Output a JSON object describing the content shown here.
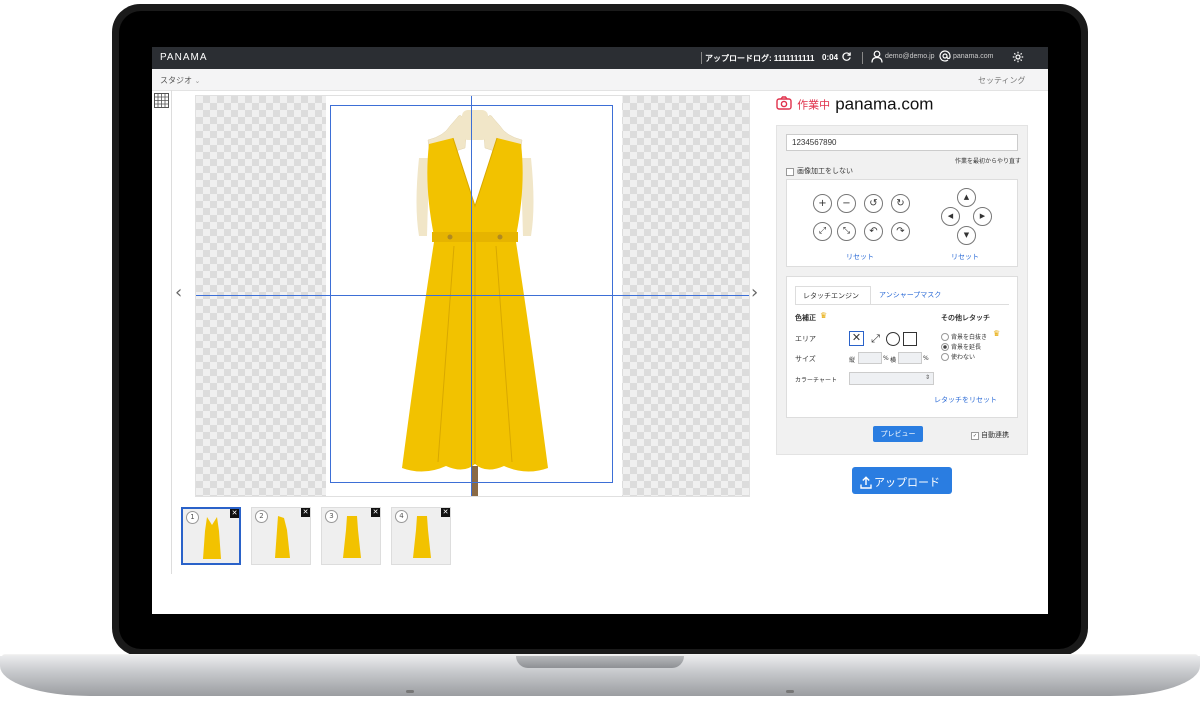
{
  "app": {
    "brand": "PANAMA",
    "upload_log_label": "アップロードログ: 1111111111",
    "timer": "0:04",
    "user_email": "demo@demo.jp",
    "domain": "panama.com"
  },
  "subbar": {
    "studio_label": "スタジオ",
    "settings_label": "セッティング"
  },
  "thumbnails": [
    {
      "num": "1",
      "selected": true
    },
    {
      "num": "2",
      "selected": false
    },
    {
      "num": "3",
      "selected": false
    },
    {
      "num": "4",
      "selected": false
    }
  ],
  "panel": {
    "status_label": "作業中",
    "site_title": "panama.com",
    "sku_value": "1234567890",
    "redo_link": "作業を最初からやり直す",
    "no_process_label": "画像加工をしない",
    "reset_left": "リセット",
    "reset_right": "リセット",
    "tab_retouch": "レタッチエンジン",
    "tab_unsharp": "アンシャープマスク",
    "color_correction": "色補正",
    "other_retouch": "その他レタッチ",
    "area_label": "エリア",
    "size_label": "サイズ",
    "size_h": "縦",
    "size_pct1": "%",
    "size_w": "横",
    "size_pct2": "%",
    "color_chart_label": "カラーチャート",
    "bg_white": "背景を白抜き",
    "bg_extend": "背景を延長",
    "bg_none": "使わない",
    "reset_retouch": "レタッチをリセット",
    "preview_button": "プレビュー",
    "auto_link_label": "自動連携",
    "upload_button": "アップロード"
  },
  "colors": {
    "accent_blue": "#2a7de1",
    "guide_blue": "#3d6fd6",
    "status_red": "#e0314b",
    "crown_gold": "#e6a800",
    "dress_yellow": "#f2c200"
  }
}
